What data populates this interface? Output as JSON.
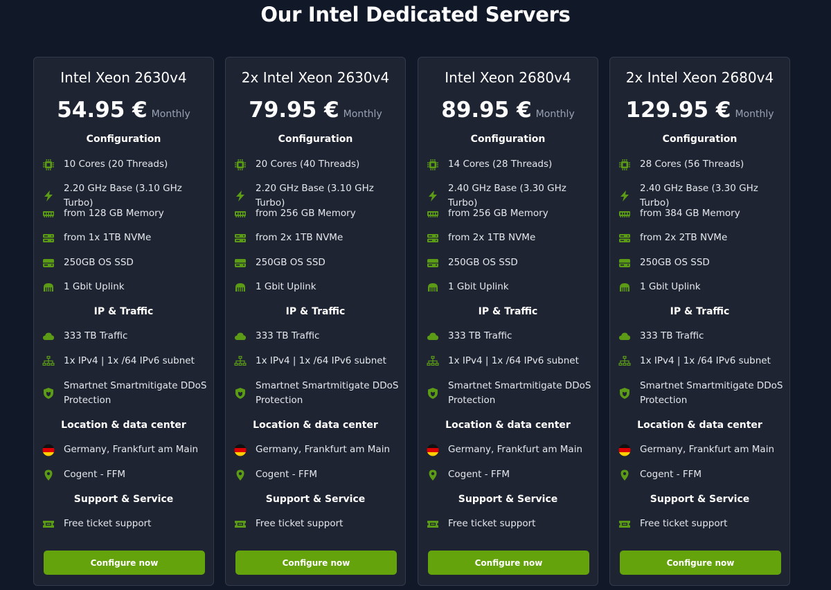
{
  "page": {
    "title": "Our Intel Dedicated Servers",
    "colors": {
      "background": "#111827",
      "card": "#1e2432",
      "card_border": "#323a4b",
      "accent": "#65a30d",
      "icon": "#5c9b16"
    }
  },
  "section_titles": {
    "configuration": "Configuration",
    "ip_traffic": "IP & Traffic",
    "location": "Location & data center",
    "support": "Support & Service"
  },
  "icons": {
    "cores": "cpu-icon",
    "clock": "lightning-icon",
    "memory": "memory-icon",
    "storage": "drive-icon",
    "os_disk": "ssd-icon",
    "uplink": "network-card-icon",
    "traffic": "cloud-icon",
    "ip": "network-icon",
    "ddos": "shield-icon",
    "location": "germany-flag-icon",
    "datacenter": "map-pin-icon",
    "support": "ticket-icon"
  },
  "plans": [
    {
      "name": "Intel Xeon 2630v4",
      "price": "54.95 €",
      "period": "Monthly",
      "cores": "10 Cores (20 Threads)",
      "clock": "2.20 GHz Base (3.10 GHz Turbo)",
      "memory": "from 128 GB Memory",
      "storage": "from 1x 1TB NVMe",
      "os_disk": "250GB OS SSD",
      "uplink": "1 Gbit Uplink",
      "traffic": "333 TB Traffic",
      "ip": "1x IPv4 | 1x /64 IPv6 subnet",
      "ddos": "Smartnet Smartmitigate DDoS Protection",
      "location": "Germany, Frankfurt am Main",
      "datacenter": "Cogent - FFM",
      "support": "Free ticket support",
      "button": "Configure now"
    },
    {
      "name": "2x Intel Xeon 2630v4",
      "price": "79.95 €",
      "period": "Monthly",
      "cores": "20 Cores (40 Threads)",
      "clock": "2.20 GHz Base (3.10 GHz Turbo)",
      "memory": "from 256 GB Memory",
      "storage": "from 2x 1TB NVMe",
      "os_disk": "250GB OS SSD",
      "uplink": "1 Gbit Uplink",
      "traffic": "333 TB Traffic",
      "ip": "1x IPv4 | 1x /64 IPv6 subnet",
      "ddos": "Smartnet Smartmitigate DDoS Protection",
      "location": "Germany, Frankfurt am Main",
      "datacenter": "Cogent - FFM",
      "support": "Free ticket support",
      "button": "Configure now"
    },
    {
      "name": "Intel Xeon 2680v4",
      "price": "89.95 €",
      "period": "Monthly",
      "cores": "14 Cores (28 Threads)",
      "clock": "2.40 GHz Base (3.30 GHz Turbo)",
      "memory": "from 256 GB Memory",
      "storage": "from 2x 1TB NVMe",
      "os_disk": "250GB OS SSD",
      "uplink": "1 Gbit Uplink",
      "traffic": "333 TB Traffic",
      "ip": "1x IPv4 | 1x /64 IPv6 subnet",
      "ddos": "Smartnet Smartmitigate DDoS Protection",
      "location": "Germany, Frankfurt am Main",
      "datacenter": "Cogent - FFM",
      "support": "Free ticket support",
      "button": "Configure now"
    },
    {
      "name": "2x Intel Xeon 2680v4",
      "price": "129.95 €",
      "period": "Monthly",
      "cores": "28 Cores (56 Threads)",
      "clock": "2.40 GHz Base (3.30 GHz Turbo)",
      "memory": "from 384 GB Memory",
      "storage": "from 2x 2TB NVMe",
      "os_disk": "250GB OS SSD",
      "uplink": "1 Gbit Uplink",
      "traffic": "333 TB Traffic",
      "ip": "1x IPv4 | 1x /64 IPv6 subnet",
      "ddos": "Smartnet Smartmitigate DDoS Protection",
      "location": "Germany, Frankfurt am Main",
      "datacenter": "Cogent - FFM",
      "support": "Free ticket support",
      "button": "Configure now"
    }
  ]
}
